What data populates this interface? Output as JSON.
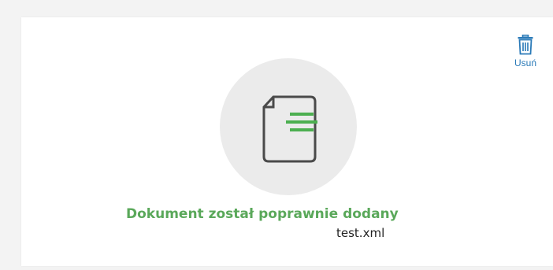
{
  "upload_card": {
    "delete_action": {
      "label": "Usuń",
      "icon": "trash-icon",
      "color": "#2a7ab8"
    },
    "document_icon": {
      "icon": "document-icon",
      "accent_color": "#4caf50",
      "circle_color": "#ebebeb"
    },
    "status_message": "Dokument został poprawnie dodany",
    "status_color": "#5aa85a",
    "file_name": "test.xml"
  }
}
